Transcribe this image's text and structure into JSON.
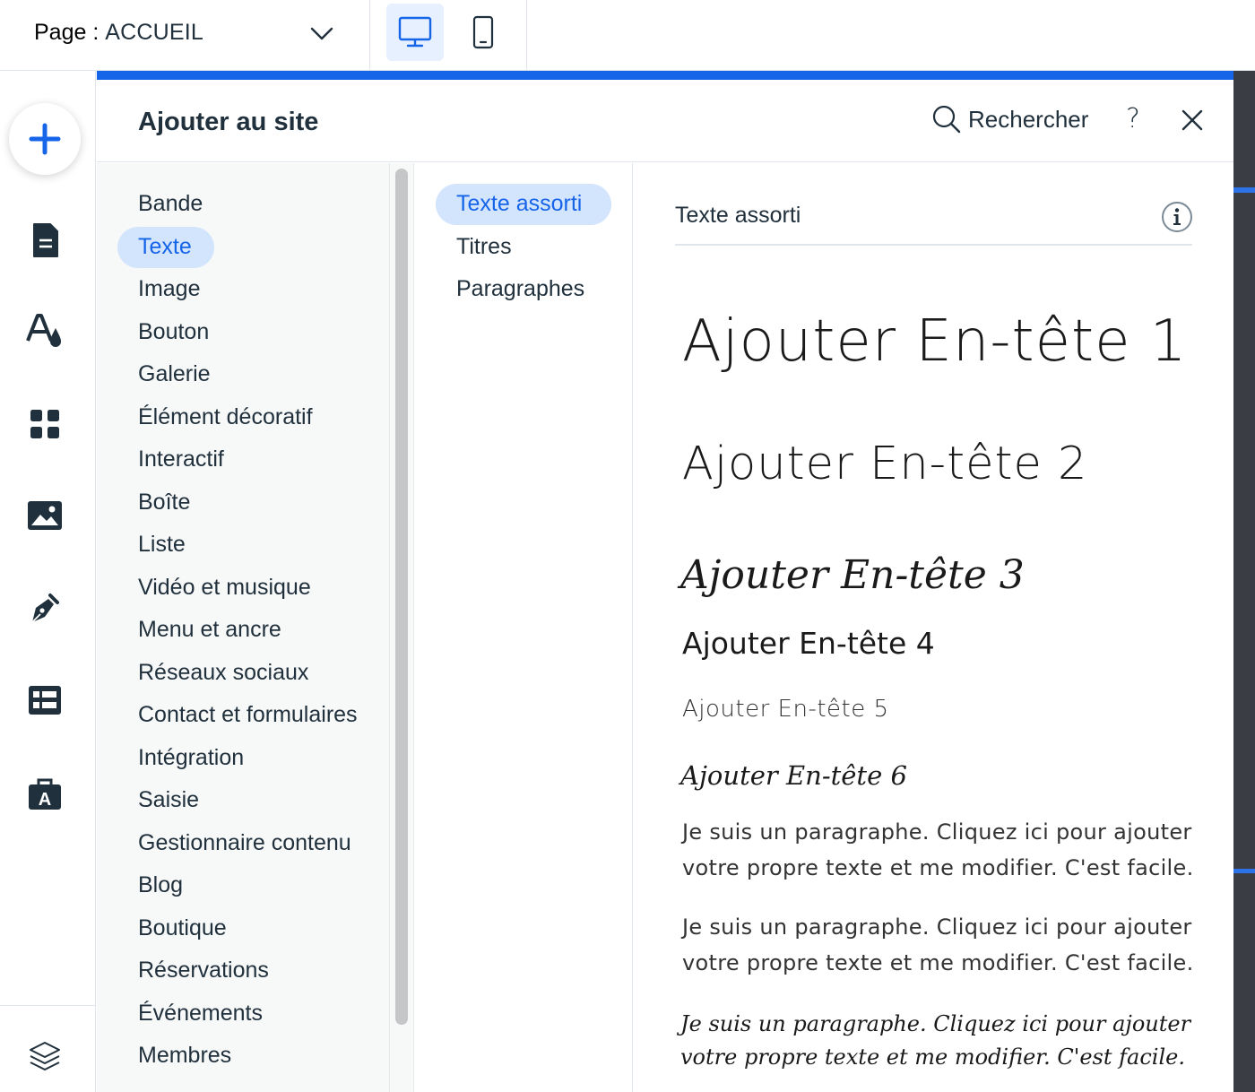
{
  "topbar": {
    "page_prefix": "Page :",
    "page_value": "ACCUEIL",
    "devices": [
      "desktop-icon",
      "mobile-icon"
    ]
  },
  "lefttool": {
    "icons": [
      "plus-icon",
      "page-icon",
      "design-icon",
      "apps-icon",
      "media-icon",
      "pen-icon",
      "table-icon",
      "business-icon",
      "layers-icon"
    ]
  },
  "panel": {
    "title": "Ajouter au site",
    "search_label": "Rechercher",
    "help_label": "?",
    "categories": [
      "Bande",
      "Texte",
      "Image",
      "Bouton",
      "Galerie",
      "Élément décoratif",
      "Interactif",
      "Boîte",
      "Liste",
      "Vidéo et musique",
      "Menu et ancre",
      "Réseaux sociaux",
      "Contact et formulaires",
      "Intégration",
      "Saisie",
      "Gestionnaire contenu",
      "Blog",
      "Boutique",
      "Réservations",
      "Événements",
      "Membres"
    ],
    "active_category": "Texte",
    "subcategories": [
      "Texte assorti",
      "Titres",
      "Paragraphes"
    ],
    "active_subcategory": "Texte assorti"
  },
  "preview": {
    "section_title": "Texte assorti",
    "headings": [
      "Ajouter En-tête 1",
      "Ajouter En-tête 2",
      "Ajouter En-tête 3",
      "Ajouter En-tête 4",
      "Ajouter En-tête 5",
      "Ajouter En-tête 6"
    ],
    "paragraphs": [
      "Je suis un paragraphe. Cliquez ici pour ajouter votre propre texte et me modifier. C'est facile.",
      "Je suis un paragraphe. Cliquez ici pour ajouter votre propre texte et me modifier. C'est facile.",
      "Je suis un paragraphe. Cliquez ici pour ajouter votre propre texte et me modifier. C'est facile."
    ]
  },
  "colors": {
    "accent": "#1665e8",
    "pill": "#d3e4fd",
    "text": "#20303c",
    "border": "#dfe5eb"
  }
}
